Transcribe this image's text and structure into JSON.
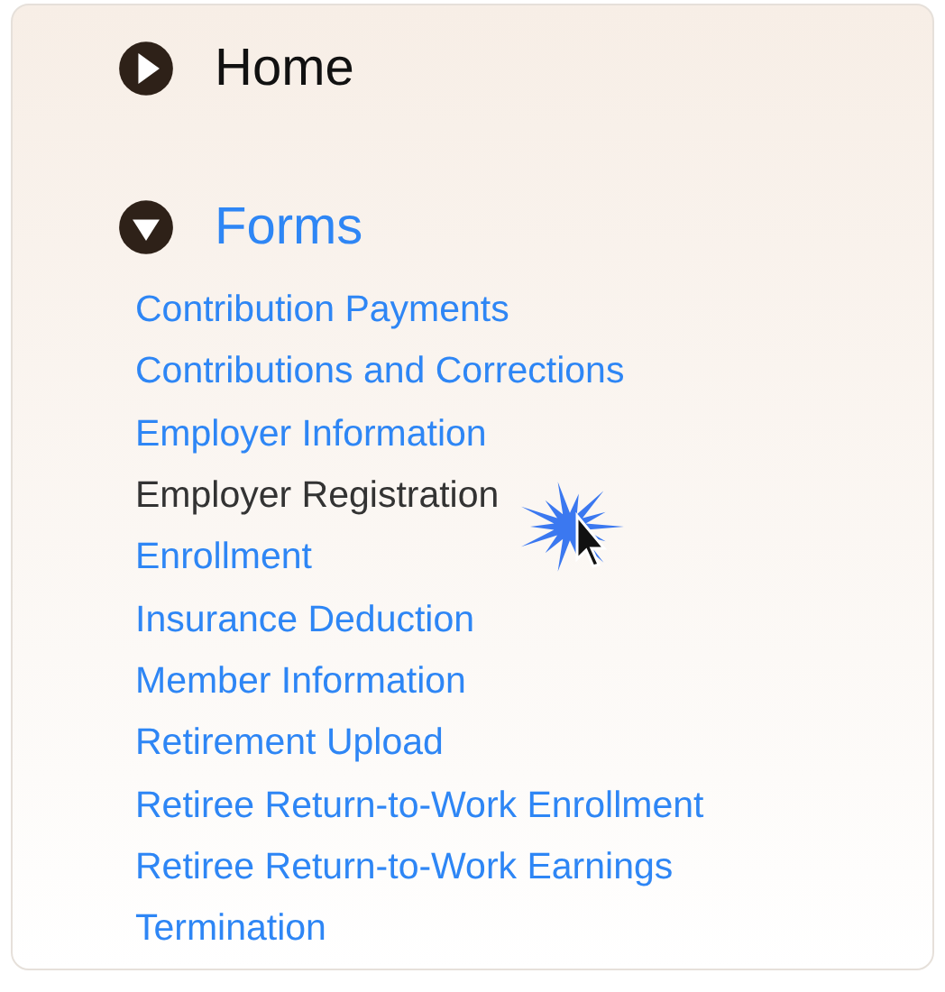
{
  "sections": [
    {
      "label": "Home",
      "expanded": false
    },
    {
      "label": "Forms",
      "expanded": true,
      "items": [
        {
          "label": "Contribution Payments",
          "hovered": false
        },
        {
          "label": "Contributions and Corrections",
          "hovered": false
        },
        {
          "label": "Employer Information",
          "hovered": false
        },
        {
          "label": "Employer Registration",
          "hovered": true
        },
        {
          "label": "Enrollment",
          "hovered": false
        },
        {
          "label": "Insurance Deduction",
          "hovered": false
        },
        {
          "label": "Member Information",
          "hovered": false
        },
        {
          "label": "Retirement Upload",
          "hovered": false
        },
        {
          "label": "Retiree Return-to-Work Enrollment",
          "hovered": false
        },
        {
          "label": "Retiree Return-to-Work Earnings",
          "hovered": false
        },
        {
          "label": "Termination",
          "hovered": false
        }
      ]
    }
  ]
}
